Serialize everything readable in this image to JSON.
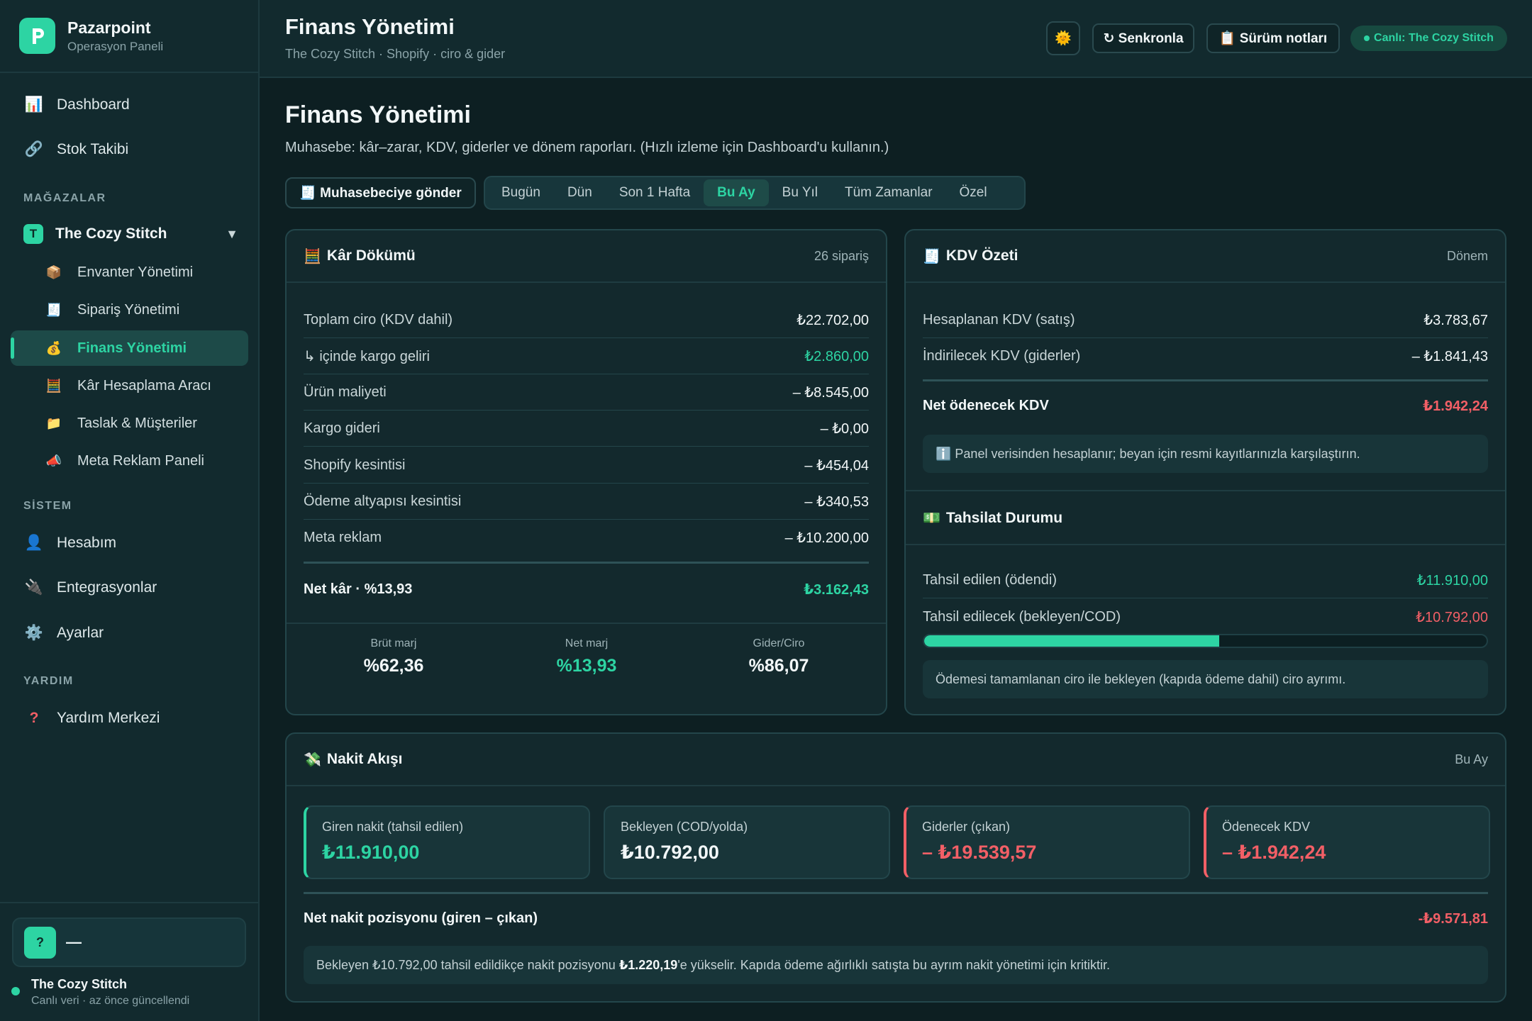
{
  "brand": {
    "name": "Pazarpoint",
    "sub": "Operasyon Paneli"
  },
  "nav": {
    "dashboard": "Dashboard",
    "stock": "Stok Takibi",
    "stores_label": "MAĞAZALAR",
    "store_badge": "T",
    "store_name": "The Cozy Stitch",
    "store_items": [
      {
        "label": "Envanter Yönetimi",
        "icon": "📦"
      },
      {
        "label": "Sipariş Yönetimi",
        "icon": "🧾"
      },
      {
        "label": "Finans Yönetimi",
        "icon": "💰"
      },
      {
        "label": "Kâr Hesaplama Aracı",
        "icon": "🧮"
      },
      {
        "label": "Taslak & Müşteriler",
        "icon": "📁"
      },
      {
        "label": "Meta Reklam Paneli",
        "icon": "📣"
      }
    ],
    "system_label": "SİSTEM",
    "account": "Hesabım",
    "integrations": "Entegrasyonlar",
    "settings": "Ayarlar",
    "help_label": "YARDIM",
    "help_center": "Yardım Merkezi"
  },
  "footer": {
    "avatar": "?",
    "user": "—",
    "store": "The Cozy Stitch",
    "status": "Canlı veri · az önce güncellendi"
  },
  "topbar": {
    "title": "Finans Yönetimi",
    "sub": "The Cozy Stitch · Shopify · ciro & gider",
    "theme_icon": "🌞",
    "sync": "↻ Senkronla",
    "notes": "📋 Sürüm notları",
    "live": "Canlı: The Cozy Stitch"
  },
  "page": {
    "title": "Finans Yönetimi",
    "desc": "Muhasebe: kâr–zarar, KDV, giderler ve dönem raporları. (Hızlı izleme için Dashboard'u kullanın.)",
    "send": "🧾 Muhasebeciye gönder",
    "ranges": [
      "Bugün",
      "Dün",
      "Son 1 Hafta",
      "Bu Ay",
      "Bu Yıl",
      "Tüm Zamanlar",
      "Özel"
    ],
    "active_range": "Bu Ay"
  },
  "profit": {
    "icon": "🧮",
    "title": "Kâr Dökümü",
    "meta": "26 sipariş",
    "rows": [
      {
        "label": "Toplam ciro (KDV dahil)",
        "value": "₺22.702,00"
      },
      {
        "label": "↳ içinde kargo geliri",
        "value": "₺2.860,00"
      },
      {
        "label": "Ürün maliyeti",
        "value": "– ₺8.545,00"
      },
      {
        "label": "Kargo gideri",
        "value": "– ₺0,00"
      },
      {
        "label": "Shopify kesintisi",
        "value": "– ₺454,04"
      },
      {
        "label": "Ödeme altyapısı kesintisi",
        "value": "– ₺340,53"
      },
      {
        "label": "Meta reklam",
        "value": "– ₺10.200,00"
      }
    ],
    "net_label": "Net kâr · %13,93",
    "net_value": "₺3.162,43",
    "margins": [
      {
        "label": "Brüt marj",
        "value": "%62,36"
      },
      {
        "label": "Net marj",
        "value": "%13,93"
      },
      {
        "label": "Gider/Ciro",
        "value": "%86,07"
      }
    ]
  },
  "vat": {
    "icon": "🧾",
    "title": "KDV Özeti",
    "meta": "Dönem",
    "rows": [
      {
        "label": "Hesaplanan KDV (satış)",
        "value": "₺3.783,67"
      },
      {
        "label": "İndirilecek KDV (giderler)",
        "value": "– ₺1.841,43"
      }
    ],
    "net_label": "Net ödenecek KDV",
    "net_value": "₺1.942,24",
    "info": "ℹ️ Panel verisinden hesaplanır; beyan için resmi kayıtlarınızla karşılaştırın."
  },
  "collection": {
    "icon": "💵",
    "title": "Tahsilat Durumu",
    "collected_label": "Tahsil edilen (ödendi)",
    "collected_value": "₺11.910,00",
    "pending_label": "Tahsil edilecek (bekleyen/COD)",
    "pending_value": "₺10.792,00",
    "progress": 0.525,
    "info": "Ödemesi tamamlanan ciro ile bekleyen (kapıda ödeme dahil) ciro ayrımı."
  },
  "cashflow": {
    "icon": "💸",
    "title": "Nakit Akışı",
    "meta": "Bu Ay",
    "boxes": [
      {
        "label": "Giren nakit (tahsil edilen)",
        "value": "₺11.910,00"
      },
      {
        "label": "Bekleyen (COD/yolda)",
        "value": "₺10.792,00"
      },
      {
        "label": "Giderler (çıkan)",
        "value": "– ₺19.539,57"
      },
      {
        "label": "Ödenecek KDV",
        "value": "– ₺1.942,24"
      }
    ],
    "net_label": "Net nakit pozisyonu (giren – çıkan)",
    "net_value": "-₺9.571,81",
    "note_prefix": "Bekleyen ₺10.792,00 tahsil edildikçe nakit pozisyonu ",
    "note_amount": "₺1.220,19",
    "note_suffix": "'e yükselir. Kapıda ödeme ağırlıklı satışta bu ayrım nakit yönetimi için kritiktir."
  },
  "colors": {
    "accent": "#2dd4a3",
    "negative": "#f25f66",
    "background": "#0d1f22"
  }
}
